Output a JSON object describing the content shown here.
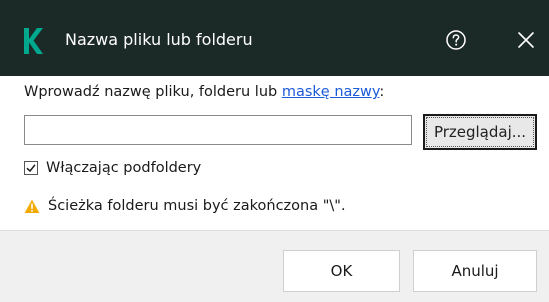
{
  "window": {
    "title": "Nazwa pliku lub folderu",
    "accent_color": "#1c2a27",
    "logo_color": "#00a88e",
    "icons": [
      "kaspersky-logo-icon",
      "help-icon",
      "close-icon"
    ]
  },
  "form": {
    "prompt_prefix": "Wprowadź nazwę pliku, folderu lub ",
    "prompt_link": "maskę nazwy",
    "prompt_suffix": ":",
    "name_input_value": "",
    "browse_label": "Przeglądaj...",
    "include_subfolders_label": "Włączając podfoldery",
    "include_subfolders_checked": true,
    "warning_text": "Ścieżka folderu musi być zakończona \"\\\".",
    "warning_color": "#f2a900"
  },
  "footer": {
    "ok_label": "OK",
    "cancel_label": "Anuluj"
  }
}
